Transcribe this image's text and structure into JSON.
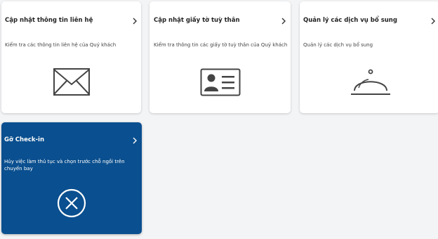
{
  "cards": [
    {
      "title": "Cập nhật thông tin liên hệ",
      "description": "Kiểm tra các thông tin liên hệ của Quý khách",
      "icon": "envelope-icon"
    },
    {
      "title": "Cập nhật giấy tờ tuỳ thân",
      "description": "Kiểm tra thông tin các giấy tờ tuỳ thân của Quý khách",
      "icon": "id-card-icon"
    },
    {
      "title": "Quản lý các dịch vụ bổ sung",
      "description": "Quản lý các dịch vụ bổ sung",
      "icon": "service-cloche-icon"
    },
    {
      "title": "Gỡ Check-in",
      "description": "Hủy việc làm thủ tục và chọn trước chỗ ngồi trên chuyến bay",
      "icon": "cancel-circle-icon"
    }
  ],
  "colors": {
    "dark_card": "#0a4f8f",
    "background": "#f3f4f6"
  }
}
